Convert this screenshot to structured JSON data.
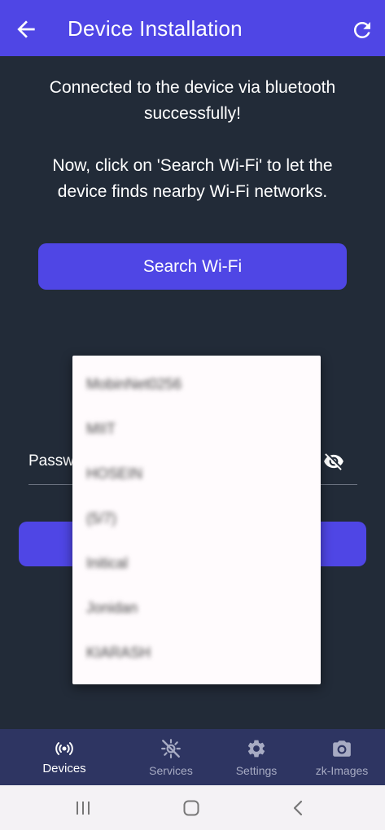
{
  "app_bar": {
    "title": "Device Installation",
    "back_icon": "arrow-left-icon",
    "refresh_icon": "refresh-icon"
  },
  "content": {
    "message_connected": "Connected to the device via bluetooth successfully!",
    "message_instruction": "Now, click on 'Search Wi-Fi' to let the device finds nearby Wi-Fi networks.",
    "search_button_label": "Search Wi-Fi",
    "password_label": "Passw",
    "password_visibility_icon": "eye-off-icon"
  },
  "wifi_dropdown": {
    "items": [
      "MobinNet0256",
      "MIIT",
      "HOSEIN",
      "(5/7)",
      "Initical",
      "Jonidan",
      "KIARASH"
    ]
  },
  "bottom_nav": {
    "items": [
      {
        "label": "Devices",
        "icon": "wifi-signal-icon",
        "active": true
      },
      {
        "label": "Services",
        "icon": "services-off-icon",
        "active": false
      },
      {
        "label": "Settings",
        "icon": "gear-icon",
        "active": false
      },
      {
        "label": "zk-Images",
        "icon": "camera-icon",
        "active": false
      }
    ]
  },
  "colors": {
    "primary": "#4f46e5",
    "background": "#222b38",
    "nav_background": "#2e3562",
    "dropdown_background": "#fffbfd"
  }
}
